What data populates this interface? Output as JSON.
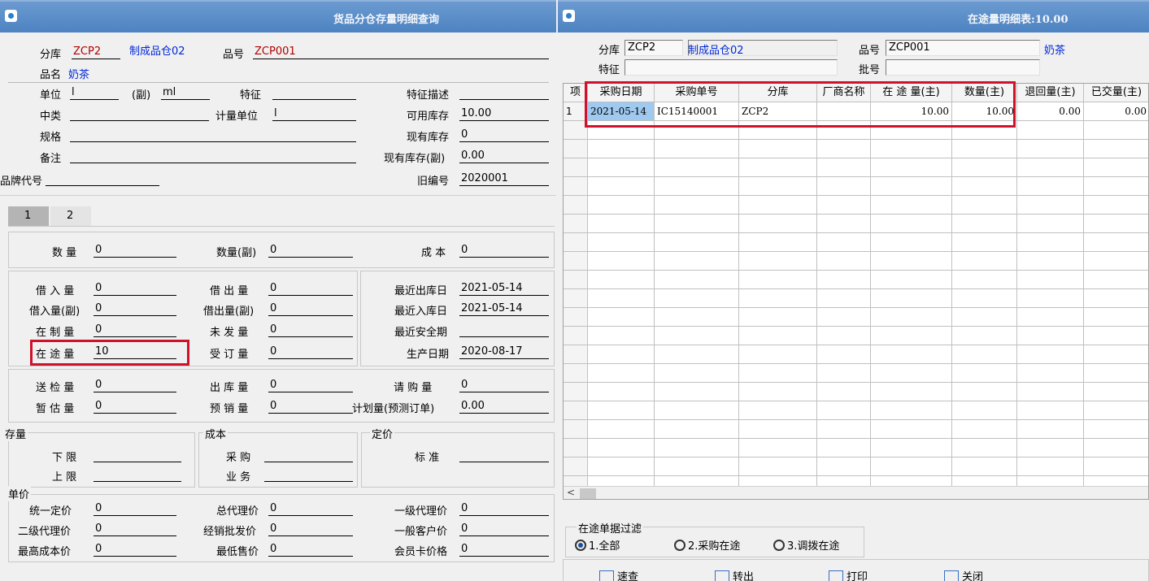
{
  "left_window": {
    "title": "货品分仓存量明细查询",
    "header": {
      "fenku_label": "分库",
      "fenku_value": "ZCP2",
      "fenku_name": "制成品仓02",
      "pinhao_label": "品号",
      "pinhao_value": "ZCP001",
      "pinming_label": "品名",
      "pinming_value": "奶茶",
      "danwei_label": "单位",
      "danwei_value": "l",
      "fu_label": "(副)",
      "fu_value": "ml",
      "tezheng_label": "特征",
      "tezheng_value": "",
      "tezheng_desc_label": "特征描述",
      "tezheng_desc_value": "",
      "zhonglei_label": "中类",
      "zhonglei_value": "",
      "jiliang_label": "计量单位",
      "jiliang_value": "l",
      "keyong_label": "可用库存",
      "keyong_value": "10.00",
      "guige_label": "规格",
      "guige_value": "",
      "xianyou_label": "现有库存",
      "xianyou_value": "0",
      "beizhu_label": "备注",
      "beizhu_value": "",
      "xianyou_fu_label": "现有库存(副)",
      "xianyou_fu_value": "0.00",
      "pinpai_label": "品牌代号",
      "pinpai_value": "",
      "jiubianhao_label": "旧编号",
      "jiubianhao_value": "2020001"
    },
    "tabs": [
      "1",
      "2"
    ],
    "qty": {
      "shuliang_label": "数  量",
      "shuliang_value": "0",
      "shuliang_fu_label": "数量(副)",
      "shuliang_fu_value": "0",
      "chengben_label": "成  本",
      "chengben_value": "0"
    },
    "mid": {
      "jieru_label": "借 入 量",
      "jieru_value": "0",
      "jiechu_label": "借 出 量",
      "jiechu_value": "0",
      "zuijin_chu_label": "最近出库日",
      "zuijin_chu_value": "2021-05-14",
      "jieru_fu_label": "借入量(副)",
      "jieru_fu_value": "0",
      "jiechu_fu_label": "借出量(副)",
      "jiechu_fu_value": "0",
      "zuijin_ru_label": "最近入库日",
      "zuijin_ru_value": "2021-05-14",
      "zaizhi_label": "在 制 量",
      "zaizhi_value": "0",
      "weifa_label": "未 发 量",
      "weifa_value": "0",
      "anquan_label": "最近安全期",
      "anquan_value": "",
      "zaitu_label": "在 途 量",
      "zaitu_value": "10",
      "shouding_label": "受 订 量",
      "shouding_value": "0",
      "shengchan_label": "生产日期",
      "shengchan_value": "2020-08-17"
    },
    "misc": {
      "songjian_label": "送 检 量",
      "songjian_value": "0",
      "chuku_label": "出 库 量",
      "chuku_value": "0",
      "qinggou_label": "请 购 量",
      "qinggou_value": "0",
      "zangu_label": "暂 估 量",
      "zangu_value": "0",
      "yuxiao_label": "预 销 量",
      "yuxiao_value": "0",
      "jihua_label": "计划量(预测订单)",
      "jihua_value": "0.00"
    },
    "stock_group": {
      "title": "存量",
      "xia_label": "下  限",
      "xia_value": "",
      "shang_label": "上  限",
      "shang_value": ""
    },
    "cost_group": {
      "title": "成本",
      "caigou_label": "采  购",
      "caigou_value": "",
      "yewu_label": "业  务",
      "yewu_value": ""
    },
    "price_group": {
      "title": "定价",
      "biaozhun_label": "标  准",
      "biaozhun_value": ""
    },
    "unit_price": {
      "title": "单价",
      "tongyi_label": "统一定价",
      "tongyi_value": "0",
      "zongdaili_label": "总代理价",
      "zongdaili_value": "0",
      "yiji_label": "一级代理价",
      "yiji_value": "0",
      "erji_label": "二级代理价",
      "erji_value": "0",
      "jingxiao_label": "经销批发价",
      "jingxiao_value": "0",
      "yiban_label": "一般客户价",
      "yiban_value": "0",
      "zuigao_label": "最高成本价",
      "zuigao_value": "0",
      "zuidi_label": "最低售价",
      "zuidi_value": "0",
      "huiyuan_label": "会员卡价格",
      "huiyuan_value": "0"
    }
  },
  "right_window": {
    "title": "在途量明细表:10.00",
    "filter": {
      "fenku_label": "分库",
      "fenku_value": "ZCP2",
      "fenku_name": "制成品仓02",
      "pinhao_label": "品号",
      "pinhao_value": "ZCP001",
      "pinming_value": "奶茶",
      "tezheng_label": "特征",
      "tezheng_value": "",
      "pihao_label": "批号",
      "pihao_value": ""
    },
    "grid": {
      "columns": [
        "项",
        "采购日期",
        "采购单号",
        "分库",
        "厂商名称",
        "在 途 量(主)",
        "数量(主)",
        "退回量(主)",
        "已交量(主)"
      ],
      "rows": [
        [
          "1",
          "2021-05-14",
          "IC15140001",
          "ZCP2",
          "",
          "10.00",
          "10.00",
          "0.00",
          "0.00"
        ]
      ]
    },
    "filter_group": {
      "title": "在途单据过滤",
      "options": [
        "1.全部",
        "2.采购在途",
        "3.调拨在途"
      ],
      "selected": "1.全部"
    },
    "buttons": [
      "速查",
      "转出",
      "打印",
      "关闭"
    ]
  }
}
